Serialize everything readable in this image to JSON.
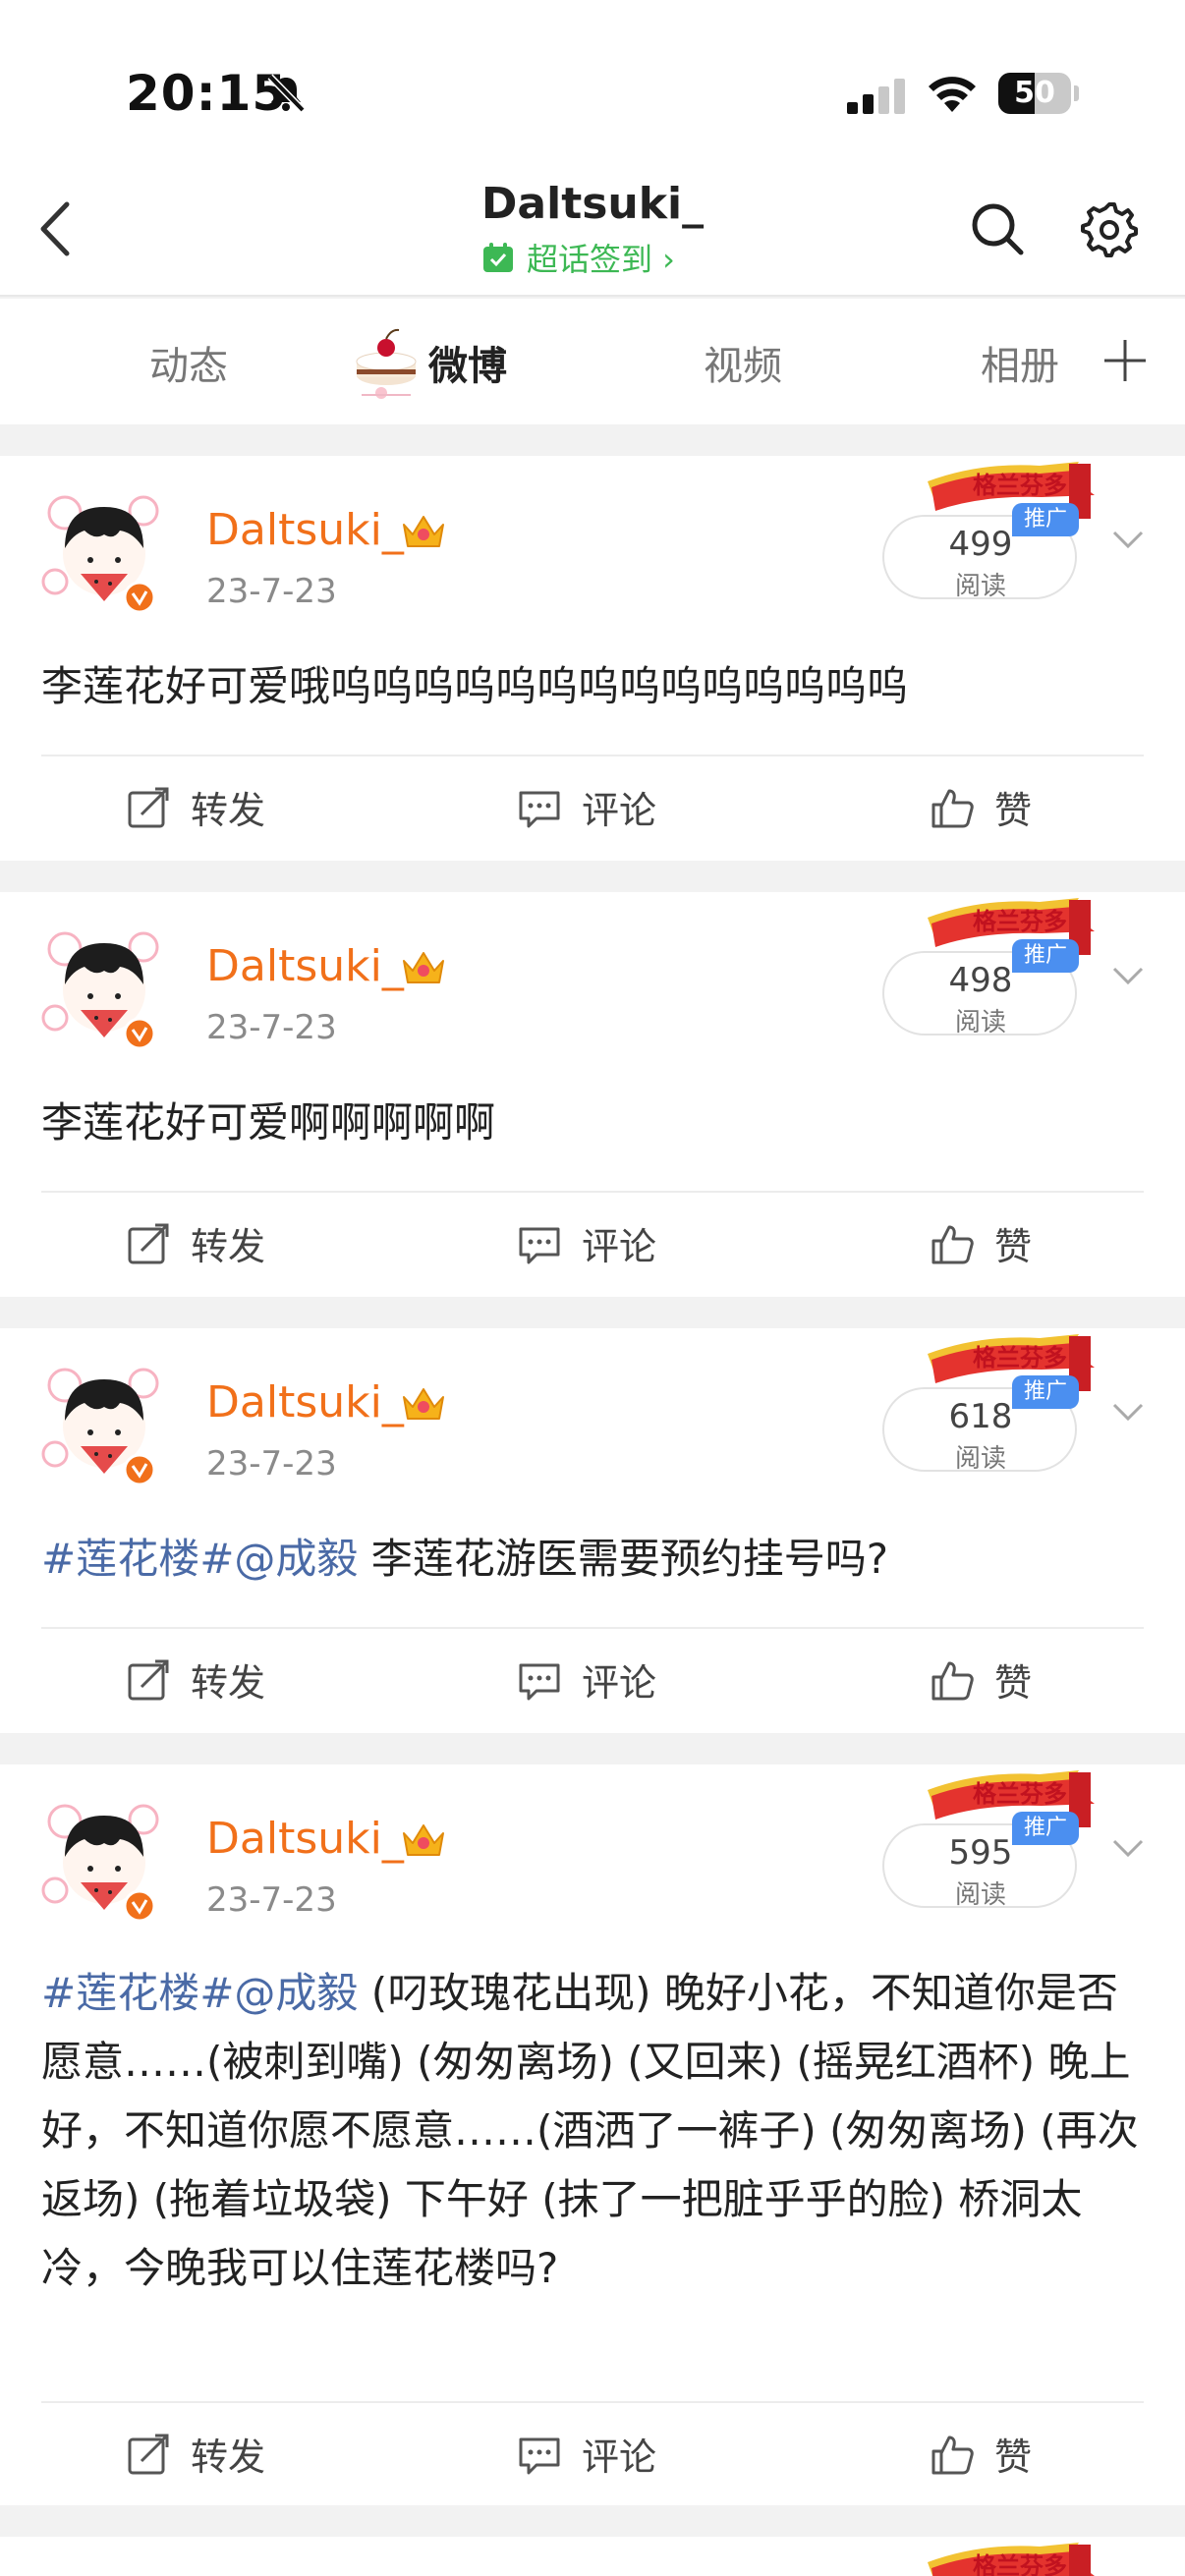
{
  "status_bar": {
    "time": "20:15",
    "battery": "50",
    "battery_level": 0.5
  },
  "header": {
    "title": "Daltsuki_",
    "supertopic": "超话签到 ›"
  },
  "tabs": [
    {
      "label": "动态"
    },
    {
      "label": "微博"
    },
    {
      "label": "视频"
    },
    {
      "label": "相册"
    }
  ],
  "posts": [
    {
      "author": "Daltsuki_",
      "date": "23-7-23",
      "read_count": "499",
      "read_label": "阅读",
      "promo": "格兰芬多",
      "badge": "推广",
      "text": "李莲花好可爱哦呜呜呜呜呜呜呜呜呜呜呜呜呜呜",
      "actions": {
        "repost": "转发",
        "comment": "评论",
        "like": "赞"
      }
    },
    {
      "author": "Daltsuki_",
      "date": "23-7-23",
      "read_count": "498",
      "read_label": "阅读",
      "promo": "格兰芬多",
      "badge": "推广",
      "text": "李莲花好可爱啊啊啊啊啊",
      "actions": {
        "repost": "转发",
        "comment": "评论",
        "like": "赞"
      }
    },
    {
      "author": "Daltsuki_",
      "date": "23-7-23",
      "read_count": "618",
      "read_label": "阅读",
      "promo": "格兰芬多",
      "badge": "推广",
      "topic": "#莲花楼#@成毅",
      "text": " 李莲花游医需要预约挂号吗?",
      "actions": {
        "repost": "转发",
        "comment": "评论",
        "like": "赞"
      }
    },
    {
      "author": "Daltsuki_",
      "date": "23-7-23",
      "read_count": "595",
      "read_label": "阅读",
      "promo": "格兰芬多",
      "badge": "推广",
      "topic": "#莲花楼#@成毅",
      "text": " (叼玫瑰花出现) 晚好小花，不知道你是否愿意……(被刺到嘴) (匆匆离场) (又回来) (摇晃红酒杯) 晚上好，不知道你愿不愿意……(酒洒了一裤子) (匆匆离场) (再次返场) (拖着垃圾袋) 下午好 (抹了一把脏乎乎的脸) 桥洞太冷，今晚我可以住莲花楼吗?",
      "actions": {
        "repost": "转发",
        "comment": "评论",
        "like": "赞"
      }
    },
    {
      "promo": "格兰芬多"
    }
  ],
  "colors": {
    "accent": "#f1701a",
    "topic": "#4a6aa6",
    "green": "#3db854",
    "badge": "#4b8ff0"
  }
}
